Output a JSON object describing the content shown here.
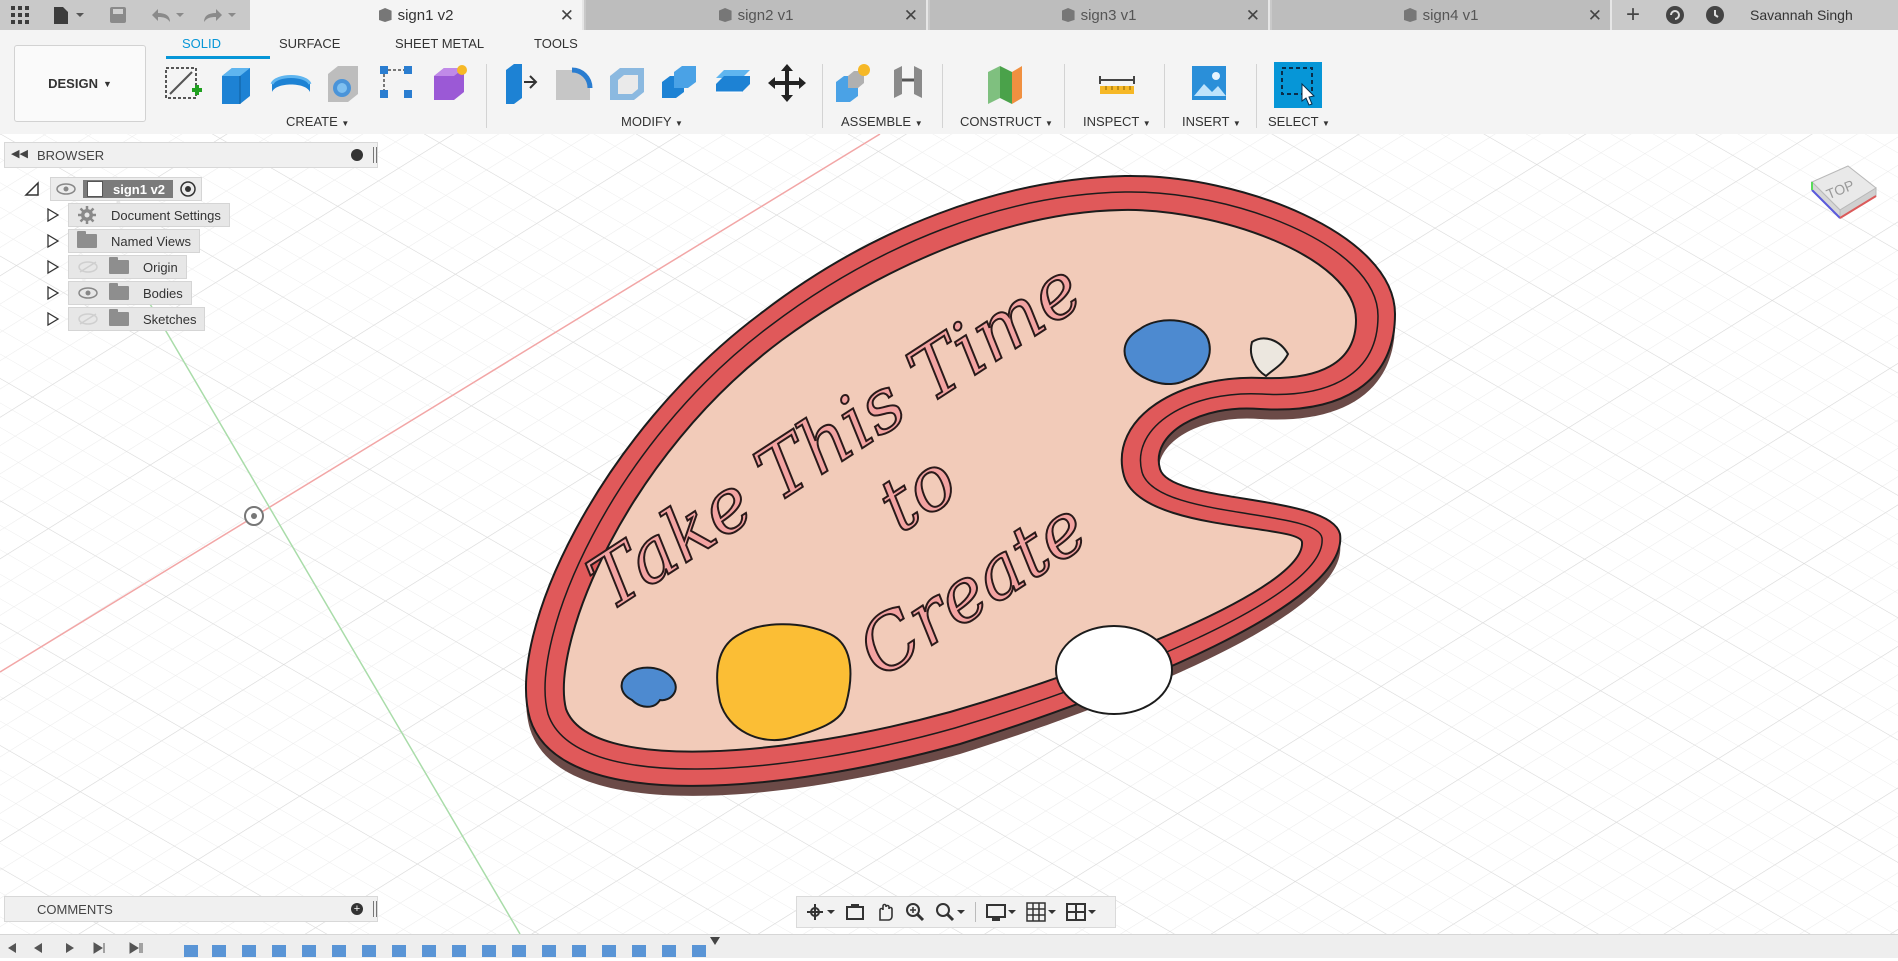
{
  "titlebar": {
    "tabs": [
      {
        "label": "sign1 v2",
        "active": true
      },
      {
        "label": "sign2 v1",
        "active": false
      },
      {
        "label": "sign3 v1",
        "active": false
      },
      {
        "label": "sign4 v1",
        "active": false
      }
    ],
    "user": "Savannah Singh",
    "close_glyph": "✕",
    "add_glyph": "+"
  },
  "ribbon": {
    "workspace": "DESIGN",
    "tabs": [
      "SOLID",
      "SURFACE",
      "SHEET METAL",
      "TOOLS"
    ],
    "active_tab": "SOLID",
    "groups": [
      "CREATE",
      "MODIFY",
      "ASSEMBLE",
      "CONSTRUCT",
      "INSPECT",
      "INSERT",
      "SELECT"
    ],
    "accent": "#0696d7"
  },
  "browser": {
    "title": "BROWSER",
    "root": "sign1 v2",
    "items": [
      "Document Settings",
      "Named Views",
      "Origin",
      "Bodies",
      "Sketches"
    ]
  },
  "comments": {
    "title": "COMMENTS"
  },
  "viewcube": {
    "face": "TOP"
  },
  "model": {
    "text_lines": [
      "Take This Time",
      "to",
      "Create"
    ],
    "colors": {
      "rim": "#e0595a",
      "face": "#f2cbb9",
      "blue": "#4d8ad0",
      "yellow": "#fbbe35",
      "white": "#ece7df"
    }
  }
}
